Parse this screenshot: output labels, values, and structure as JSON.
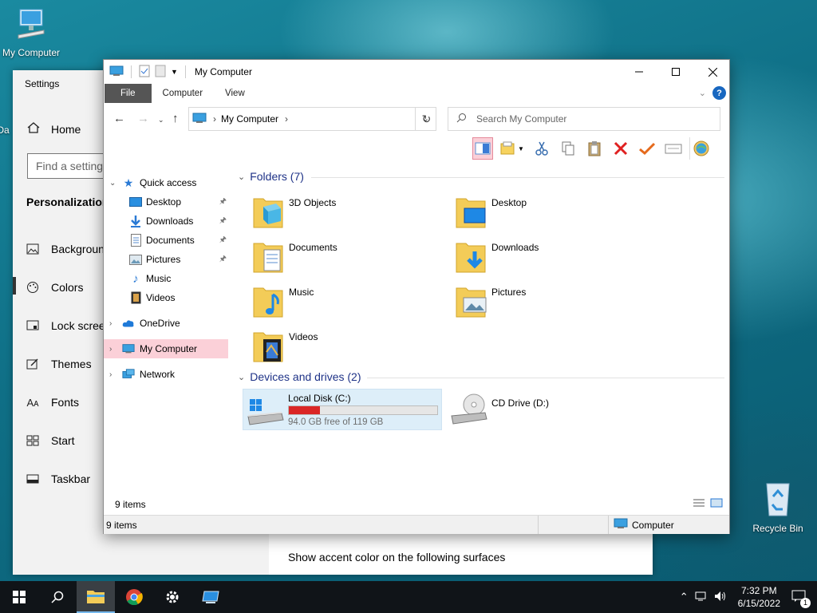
{
  "desktop": {
    "icons": [
      {
        "label": "My Computer",
        "icon": "my-computer-icon"
      },
      {
        "label": "Da",
        "icon": "partially-hidden-icon"
      },
      {
        "label": "Recycle Bin",
        "icon": "recycle-bin-icon"
      }
    ]
  },
  "settings": {
    "title": "Settings",
    "home": "Home",
    "search_placeholder": "Find a setting",
    "section": "Personalization",
    "nav": [
      {
        "label": "Background",
        "icon": "image-icon"
      },
      {
        "label": "Colors",
        "icon": "palette-icon"
      },
      {
        "label": "Lock screen",
        "icon": "lock-screen-icon"
      },
      {
        "label": "Themes",
        "icon": "themes-icon"
      },
      {
        "label": "Fonts",
        "icon": "fonts-icon"
      },
      {
        "label": "Start",
        "icon": "start-icon"
      },
      {
        "label": "Taskbar",
        "icon": "taskbar-icon"
      }
    ],
    "content_text": "Show accent color on the following surfaces"
  },
  "explorer": {
    "title": "My Computer",
    "tabs": [
      "File",
      "Computer",
      "View"
    ],
    "address": {
      "crumb": "My Computer"
    },
    "search_placeholder": "Search My Computer",
    "nav": {
      "quick_access": "Quick access",
      "quick_items": [
        "Desktop",
        "Downloads",
        "Documents",
        "Pictures",
        "Music",
        "Videos"
      ],
      "onedrive": "OneDrive",
      "my_computer": "My Computer",
      "network": "Network"
    },
    "folders_header": "Folders (7)",
    "folders": [
      "3D Objects",
      "Desktop",
      "Documents",
      "Downloads",
      "Music",
      "Pictures",
      "Videos"
    ],
    "devices_header": "Devices and drives (2)",
    "drives": [
      {
        "name": "Local Disk (C:)",
        "free": "94.0 GB free of 119 GB",
        "used_fraction": 0.21
      },
      {
        "name": "CD Drive (D:)"
      }
    ],
    "item_count": "9 items",
    "status_count": "9 items",
    "status_location": "Computer"
  },
  "taskbar": {
    "time": "7:32 PM",
    "date": "6/15/2022",
    "notification_count": "1"
  },
  "colors": {
    "accent_pink": "#fbd0d8",
    "folder_header_blue": "#1e3287",
    "drive_bar_red": "#da2626"
  }
}
